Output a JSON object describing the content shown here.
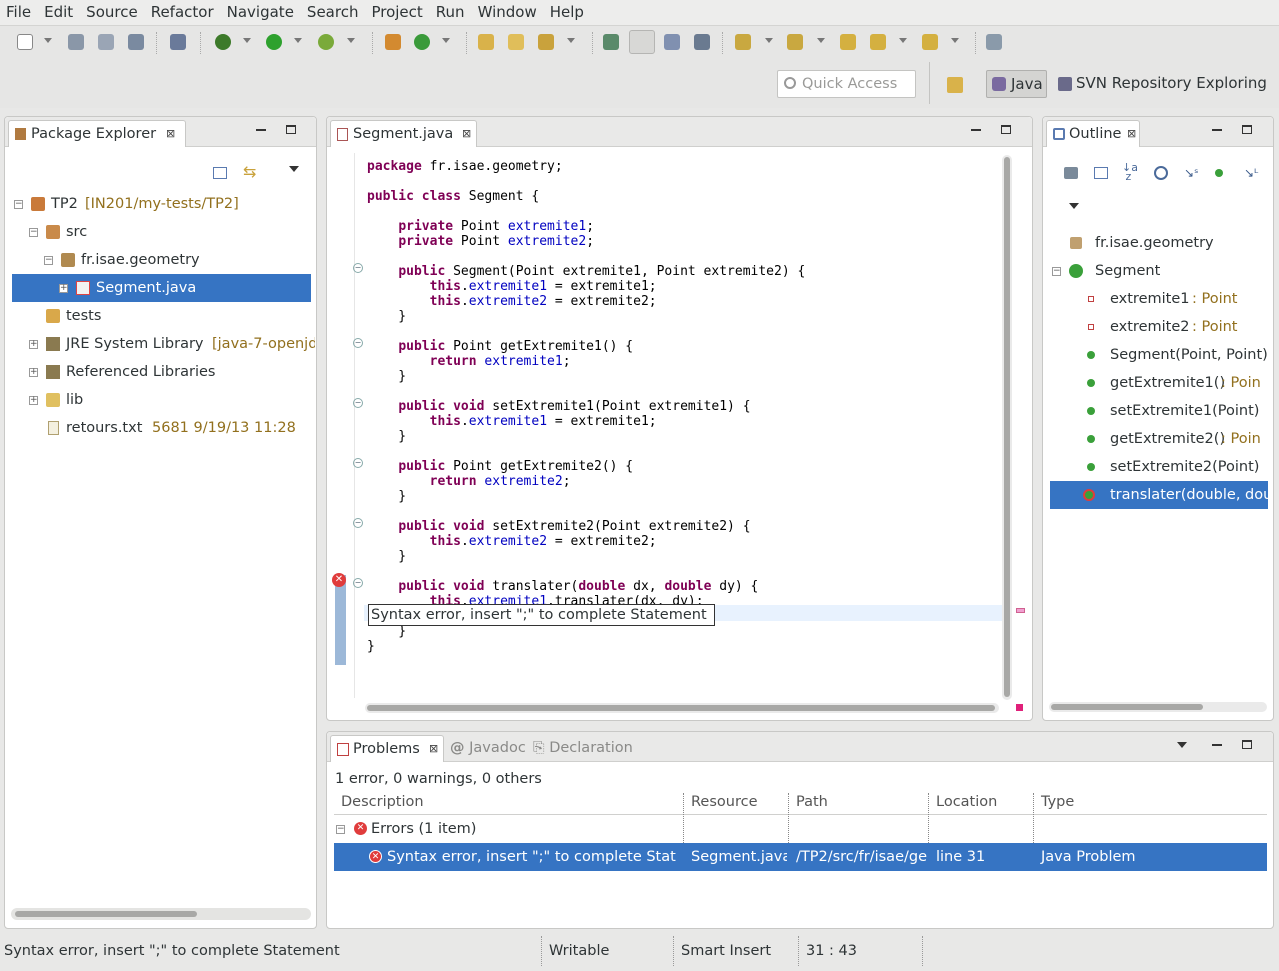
{
  "menu": [
    "File",
    "Edit",
    "Source",
    "Refactor",
    "Navigate",
    "Search",
    "Project",
    "Run",
    "Window",
    "Help"
  ],
  "quick_access": {
    "placeholder": "Quick Access"
  },
  "perspectives": {
    "java": "Java",
    "svn": "SVN Repository Exploring"
  },
  "package_explorer": {
    "title": "Package Explorer",
    "items": [
      {
        "label": "TP2",
        "deco": "[IN201/my-tests/TP2]"
      },
      {
        "label": "src"
      },
      {
        "label": "fr.isae.geometry"
      },
      {
        "label": "Segment.java"
      },
      {
        "label": "tests"
      },
      {
        "label": "JRE System Library",
        "deco": "[java-7-openjd"
      },
      {
        "label": "Referenced Libraries"
      },
      {
        "label": "lib"
      },
      {
        "label": "retours.txt",
        "deco": "5681  9/19/13 11:28"
      }
    ]
  },
  "editor": {
    "tab": "Segment.java",
    "tooltip": "Syntax error, insert \";\" to complete Statement"
  },
  "outline": {
    "title": "Outline",
    "package": "fr.isae.geometry",
    "class": "Segment",
    "members": [
      {
        "name": "extremite1",
        "type": " : Point"
      },
      {
        "name": "extremite2",
        "type": " : Point"
      },
      {
        "name": "Segment(Point, Point)",
        "type": ""
      },
      {
        "name": "getExtremite1()",
        "type": " : Poin"
      },
      {
        "name": "setExtremite1(Point)",
        "type": ""
      },
      {
        "name": "getExtremite2()",
        "type": " : Poin"
      },
      {
        "name": "setExtremite2(Point)",
        "type": ""
      },
      {
        "name": "translater(double, dou",
        "type": ""
      }
    ]
  },
  "problems": {
    "tabs": [
      "Problems",
      "Javadoc",
      "Declaration"
    ],
    "summary": "1 error, 0 warnings, 0 others",
    "columns": [
      "Description",
      "Resource",
      "Path",
      "Location",
      "Type"
    ],
    "group": "Errors (1 item)",
    "row": {
      "description": "Syntax error, insert \";\" to complete Stat",
      "resource": "Segment.java",
      "path": "/TP2/src/fr/isae/ge",
      "location": "line 31",
      "type": "Java Problem"
    }
  },
  "statusbar": {
    "message": "Syntax error, insert \";\" to complete Statement",
    "writable": "Writable",
    "insert": "Smart Insert",
    "position": "31 : 43"
  },
  "colors": {
    "selection": "#3674c3",
    "error": "#e03c3c",
    "keyword": "#7f0055",
    "field": "#0000c0",
    "decoration": "#92701e"
  }
}
